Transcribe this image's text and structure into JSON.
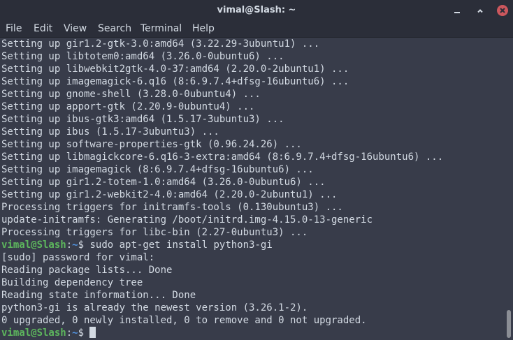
{
  "window": {
    "title": "vimal@Slash: ~",
    "controls": [
      "minimize-icon",
      "maximize-icon",
      "close-icon"
    ],
    "close_color": "#cc575d"
  },
  "menu": {
    "items": [
      "File",
      "Edit",
      "View",
      "Search",
      "Terminal",
      "Help"
    ]
  },
  "terminal": {
    "colors": {
      "foreground": "#d3dae3",
      "background": "#383c4a",
      "prompt_user": "#5db65d",
      "prompt_path": "#5294e2"
    },
    "output_lines": [
      "Setting up gir1.2-gtk-3.0:amd64 (3.22.29-3ubuntu1) ...",
      "Setting up libtotem0:amd64 (3.26.0-0ubuntu6) ...",
      "Setting up libwebkit2gtk-4.0-37:amd64 (2.20.0-2ubuntu1) ...",
      "Setting up imagemagick-6.q16 (8:6.9.7.4+dfsg-16ubuntu6) ...",
      "Setting up gnome-shell (3.28.0-0ubuntu4) ...",
      "Setting up apport-gtk (2.20.9-0ubuntu4) ...",
      "Setting up ibus-gtk3:amd64 (1.5.17-3ubuntu3) ...",
      "Setting up ibus (1.5.17-3ubuntu3) ...",
      "Setting up software-properties-gtk (0.96.24.26) ...",
      "Setting up libmagickcore-6.q16-3-extra:amd64 (8:6.9.7.4+dfsg-16ubuntu6) ...",
      "Setting up imagemagick (8:6.9.7.4+dfsg-16ubuntu6) ...",
      "Setting up gir1.2-totem-1.0:amd64 (3.26.0-0ubuntu6) ...",
      "Setting up gir1.2-webkit2-4.0:amd64 (2.20.0-2ubuntu1) ...",
      "Processing triggers for initramfs-tools (0.130ubuntu3) ...",
      "update-initramfs: Generating /boot/initrd.img-4.15.0-13-generic",
      "Processing triggers for libc-bin (2.27-0ubuntu3) ..."
    ],
    "prompt": {
      "user_host": "vimal@Slash",
      "separator": ":",
      "path": "~",
      "symbol": "$",
      "command": " sudo apt-get install python3-gi"
    },
    "result_lines": [
      "[sudo] password for vimal:",
      "Reading package lists... Done",
      "Building dependency tree",
      "Reading state information... Done",
      "python3-gi is already the newest version (3.26.1-2).",
      "0 upgraded, 0 newly installed, 0 to remove and 0 not upgraded."
    ],
    "final_prompt": {
      "user_host": "vimal@Slash",
      "separator": ":",
      "path": "~",
      "symbol": "$",
      "command": " "
    }
  }
}
